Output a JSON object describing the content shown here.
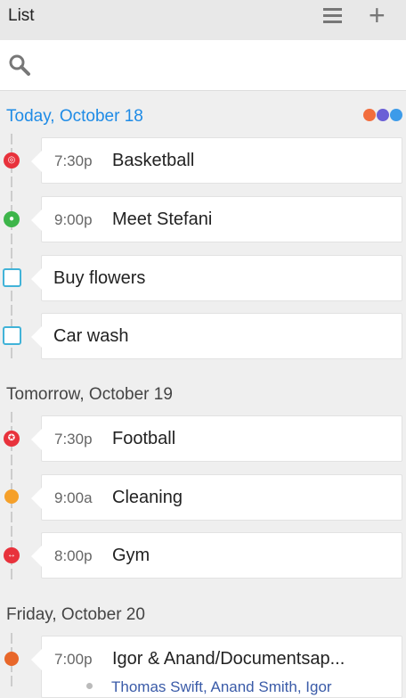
{
  "header": {
    "title": "List"
  },
  "search": {
    "placeholder": ""
  },
  "colors": {
    "accent": "#1e8be6",
    "calendar_dots": [
      "#f26d3d",
      "#6a5fd6",
      "#3d9be9"
    ]
  },
  "sections": [
    {
      "label": "Today, October 18",
      "items": [
        {
          "time": "7:30p",
          "name": "Basketball",
          "icon": "basketball-icon",
          "color": "#e8323c"
        },
        {
          "time": "9:00p",
          "name": "Meet Stefani",
          "icon": "location-pin-icon",
          "color": "#3db54a"
        },
        {
          "name": "Buy flowers",
          "icon": "checkbox"
        },
        {
          "name": "Car wash",
          "icon": "checkbox"
        }
      ]
    },
    {
      "label": "Tomorrow, October 19",
      "items": [
        {
          "time": "7:30p",
          "name": "Football",
          "icon": "soccer-ball-icon",
          "color": "#e8323c"
        },
        {
          "time": "9:00a",
          "name": "Cleaning",
          "icon": "dot-icon",
          "color": "#f5a02a"
        },
        {
          "time": "8:00p",
          "name": "Gym",
          "icon": "dumbbell-icon",
          "color": "#e8323c"
        }
      ]
    },
    {
      "label": "Friday, October 20",
      "items": [
        {
          "time": "7:00p",
          "name": "Igor & Anand/Documentsap...",
          "icon": "dot-icon",
          "color": "#e8672a",
          "attendees": "Thomas Swift, Anand Smith, Igor"
        }
      ]
    }
  ]
}
